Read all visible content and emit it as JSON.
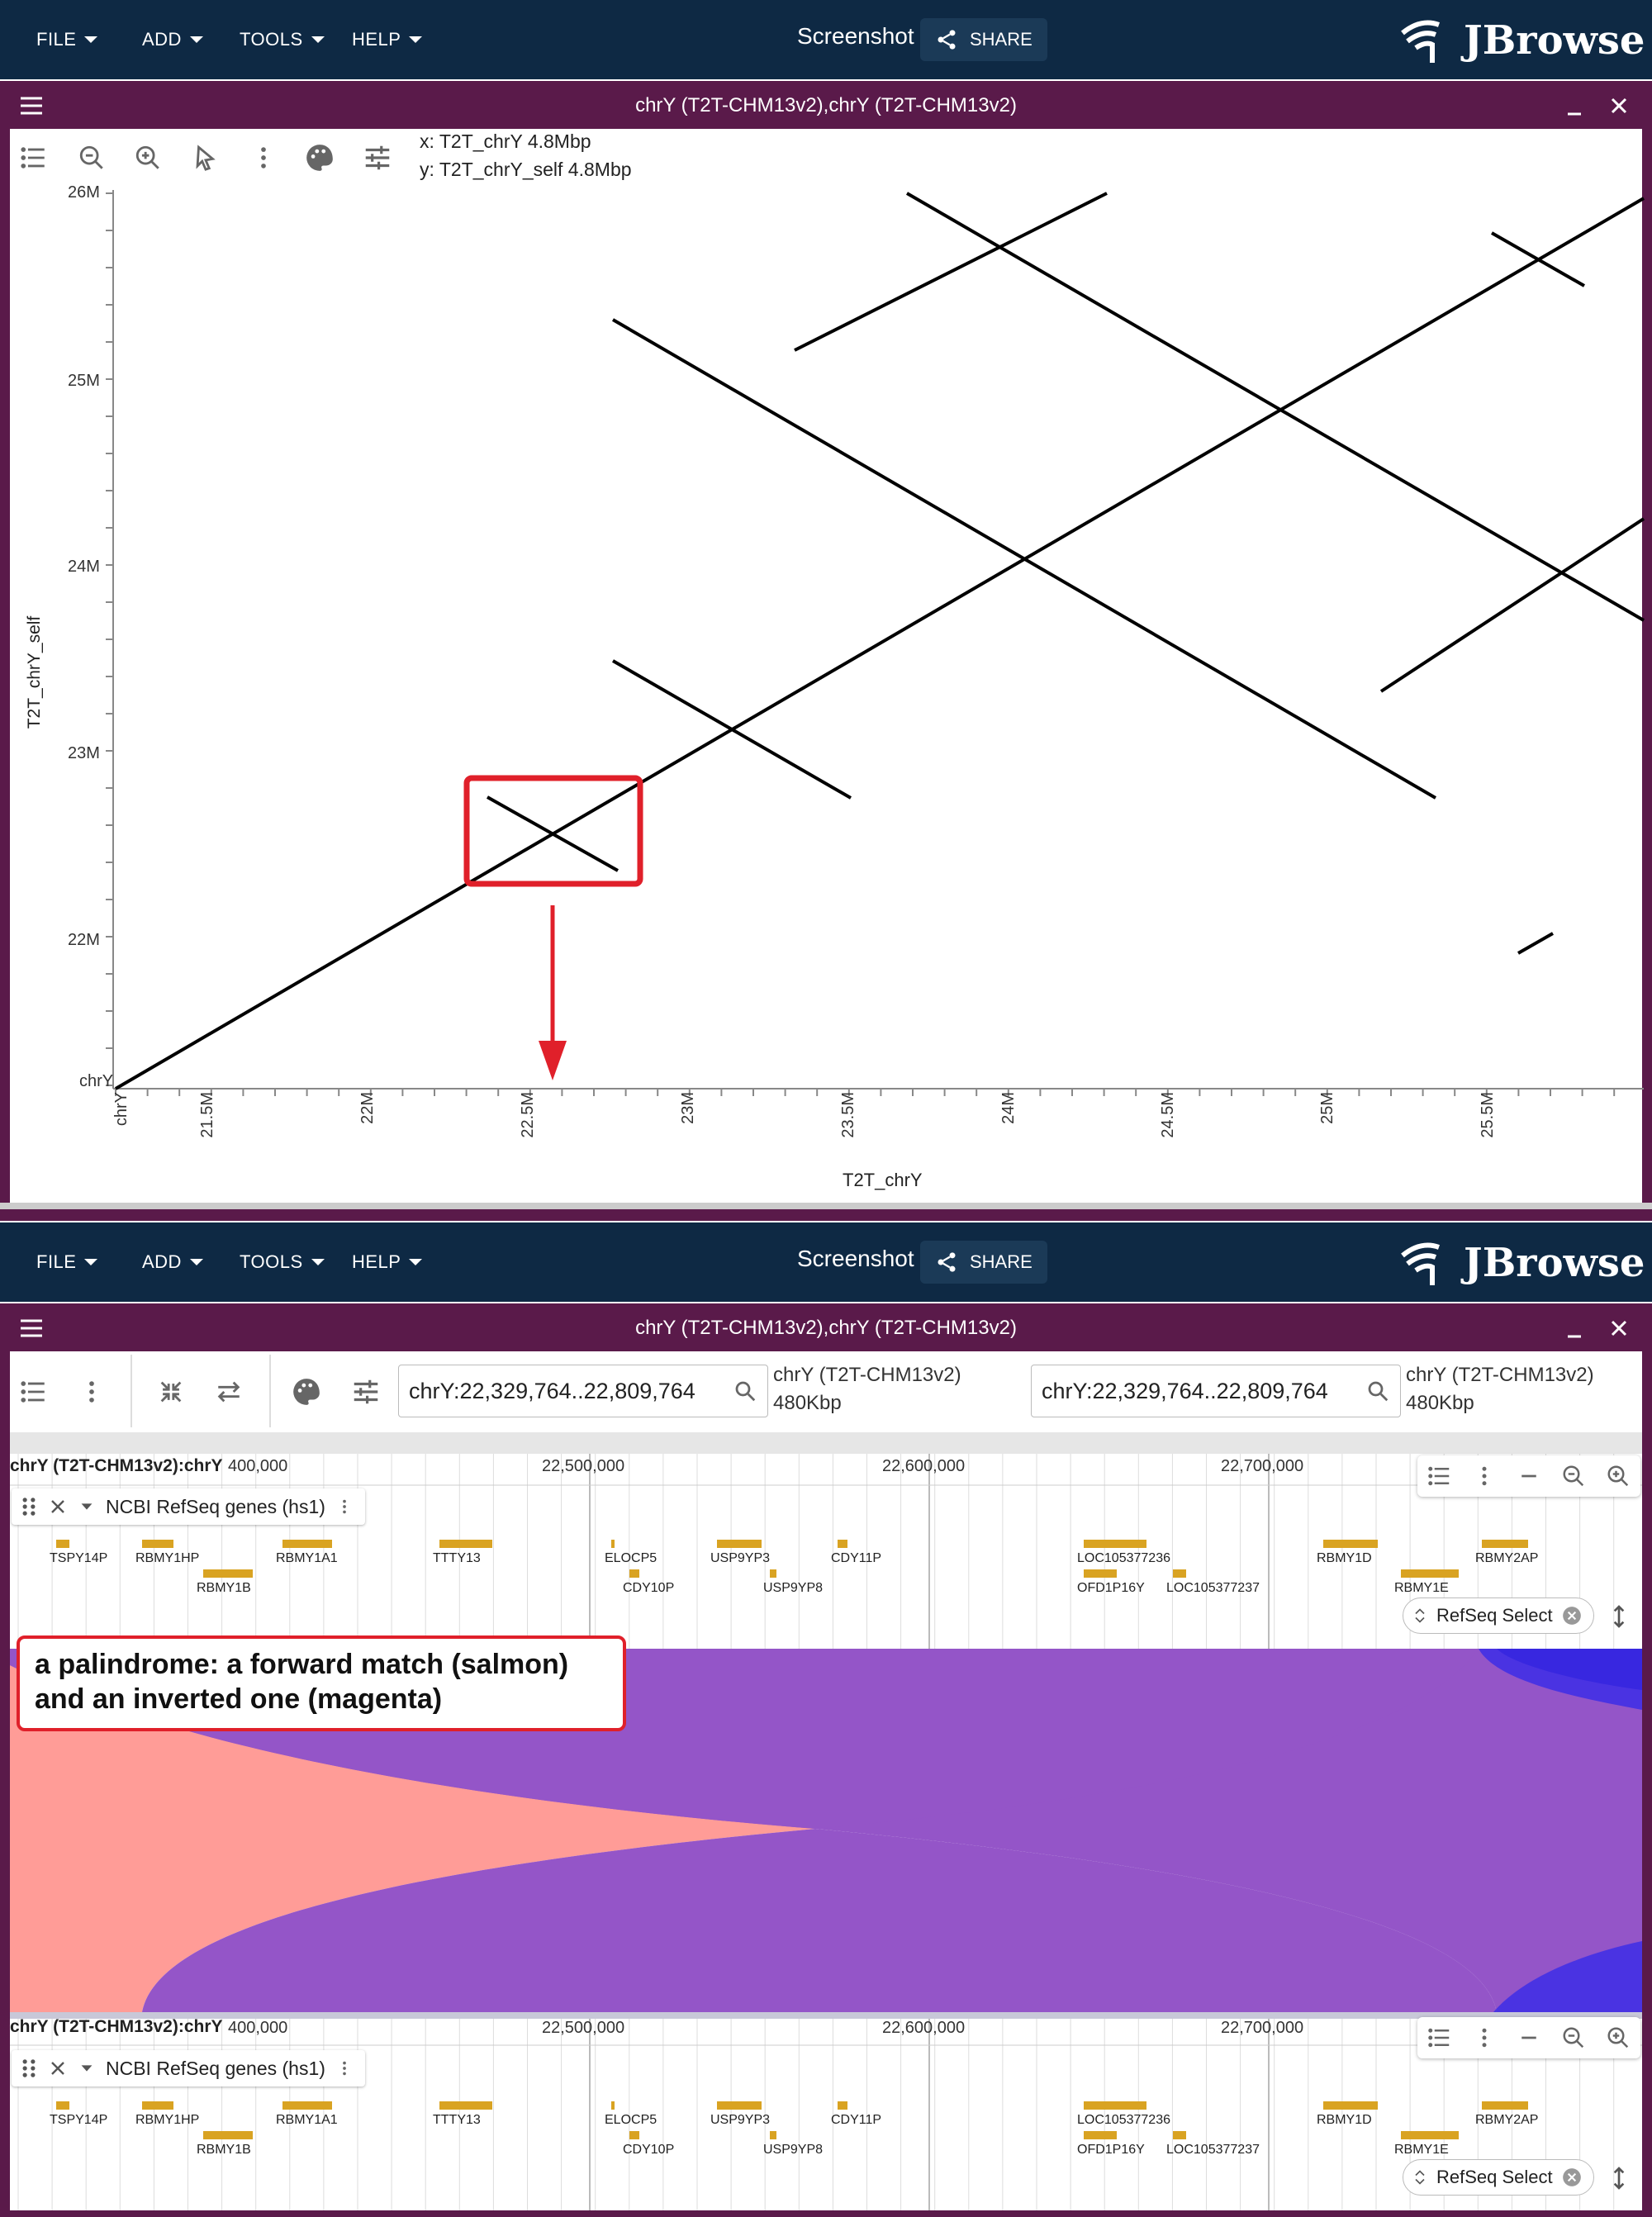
{
  "menus": {
    "file": "FILE",
    "add": "ADD",
    "tools": "TOOLS",
    "help": "HELP"
  },
  "header": {
    "screenshot": "Screenshot",
    "share": "SHARE",
    "logo": "JBrowse"
  },
  "dotplot": {
    "title": "chrY (T2T-CHM13v2),chrY (T2T-CHM13v2)",
    "coord_x": "x: T2T_chrY 4.8Mbp",
    "coord_y": "y: T2T_chrY_self 4.8Mbp",
    "xlabel": "T2T_chrY",
    "ylabel": "T2T_chrY_self",
    "x_origin": "chrY",
    "y_origin": "chrY",
    "x_ticks": [
      "21.5M",
      "22M",
      "22.5M",
      "23M",
      "23.5M",
      "24M",
      "24.5M",
      "25M",
      "25.5M"
    ],
    "y_ticks": [
      "26M",
      "25M",
      "24M",
      "23M",
      "22M"
    ]
  },
  "synteny": {
    "title": "chrY (T2T-CHM13v2),chrY (T2T-CHM13v2)",
    "search1": "chrY:22,329,764..22,809,764",
    "search2": "chrY:22,329,764..22,809,764",
    "asm1": "chrY (T2T-CHM13v2)",
    "size1": "480Kbp",
    "asm2": "chrY (T2T-CHM13v2)",
    "size2": "480Kbp",
    "callout": [
      "a palindrome: a forward match (salmon)",
      "and an inverted one (magenta)"
    ],
    "ruler": {
      "ref": "chrY (T2T-CHM13v2):chrY",
      "ticks": [
        "400,000",
        "22,500,000",
        "22,600,000",
        "22,700,000"
      ]
    },
    "track_name": "NCBI RefSeq genes (hs1)",
    "chip": "RefSeq Select",
    "genes_row1": [
      "TSPY14P",
      "RBMY1HP",
      "RBMY1A1",
      "TTTY13",
      "ELOCP5",
      "USP9YP3",
      "CDY11P",
      "LOC105377236",
      "RBMY1D",
      "RBMY2AP"
    ],
    "genes_row2": [
      "RBMY1B",
      "CDY10P",
      "USP9YP8",
      "OFD1P16Y",
      "LOC105377237",
      "RBMY1E"
    ],
    "colors": {
      "forward": "#ff9c97",
      "inverted": "#9455c8",
      "appbar": "#0e2944",
      "viewbar": "#5a1a4a",
      "gene": "#d9a322"
    }
  }
}
